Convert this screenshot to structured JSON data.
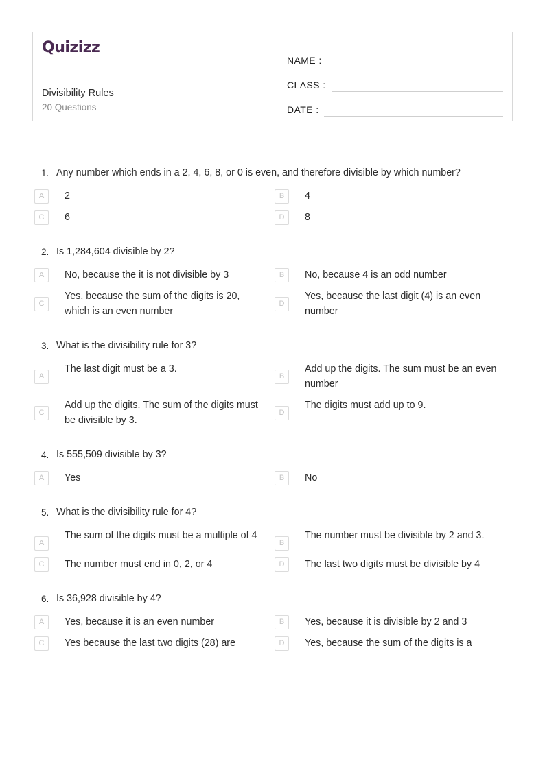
{
  "header": {
    "logo_text": "Quizizz",
    "quiz_title": "Divisibility Rules",
    "question_count": "20 Questions",
    "fields": [
      {
        "label": "NAME :",
        "value": ""
      },
      {
        "label": "CLASS :",
        "value": ""
      },
      {
        "label": "DATE  :",
        "value": ""
      }
    ]
  },
  "questions": [
    {
      "number": "1.",
      "text": "Any number which ends in a 2, 4, 6, 8, or 0 is even, and therefore divisible by which number?",
      "options": [
        {
          "letter": "A",
          "text": "2"
        },
        {
          "letter": "B",
          "text": "4"
        },
        {
          "letter": "C",
          "text": "6"
        },
        {
          "letter": "D",
          "text": "8"
        }
      ]
    },
    {
      "number": "2.",
      "text": "Is 1,284,604 divisible by 2?",
      "options": [
        {
          "letter": "A",
          "text": "No, because the it is not divisible by 3"
        },
        {
          "letter": "B",
          "text": "No, because 4 is an odd number"
        },
        {
          "letter": "C",
          "text": "Yes, because the sum of the digits is 20, which is an even number"
        },
        {
          "letter": "D",
          "text": "Yes, because the last digit (4) is an even number"
        }
      ]
    },
    {
      "number": "3.",
      "text": "What is the divisibility rule for 3?",
      "options": [
        {
          "letter": "A",
          "text": "The last digit must be a 3."
        },
        {
          "letter": "B",
          "text": "Add up the digits. The sum must be an even number"
        },
        {
          "letter": "C",
          "text": "Add up the digits. The sum of the digits must be divisible by 3."
        },
        {
          "letter": "D",
          "text": "The digits must add up to 9."
        }
      ]
    },
    {
      "number": "4.",
      "text": "Is 555,509 divisible by 3?",
      "options": [
        {
          "letter": "A",
          "text": "Yes"
        },
        {
          "letter": "B",
          "text": "No"
        }
      ]
    },
    {
      "number": "5.",
      "text": "What is the divisibility rule for 4?",
      "options": [
        {
          "letter": "A",
          "text": "The sum of the digits must be a multiple of 4"
        },
        {
          "letter": "B",
          "text": "The number must be divisible by 2 and 3."
        },
        {
          "letter": "C",
          "text": "The number must end in 0, 2, or 4"
        },
        {
          "letter": "D",
          "text": "The last two digits must be divisible by 4"
        }
      ]
    },
    {
      "number": "6.",
      "text": "Is 36,928 divisible by 4?",
      "options": [
        {
          "letter": "A",
          "text": "Yes, because it is an even number"
        },
        {
          "letter": "B",
          "text": "Yes, because it is divisible by 2 and 3"
        },
        {
          "letter": "C",
          "text": "Yes because the last two digits (28) are"
        },
        {
          "letter": "D",
          "text": "Yes, because the sum of the digits is a"
        }
      ]
    }
  ],
  "colors": {
    "logo": "#4a2a52",
    "text": "#2d2d2d",
    "muted": "#8a8a8a",
    "letter_box_border": "#dcdcdc",
    "letter_box_text": "#c5c5c5",
    "card_border": "#d8d8d8",
    "field_line": "#cfcfcf"
  }
}
